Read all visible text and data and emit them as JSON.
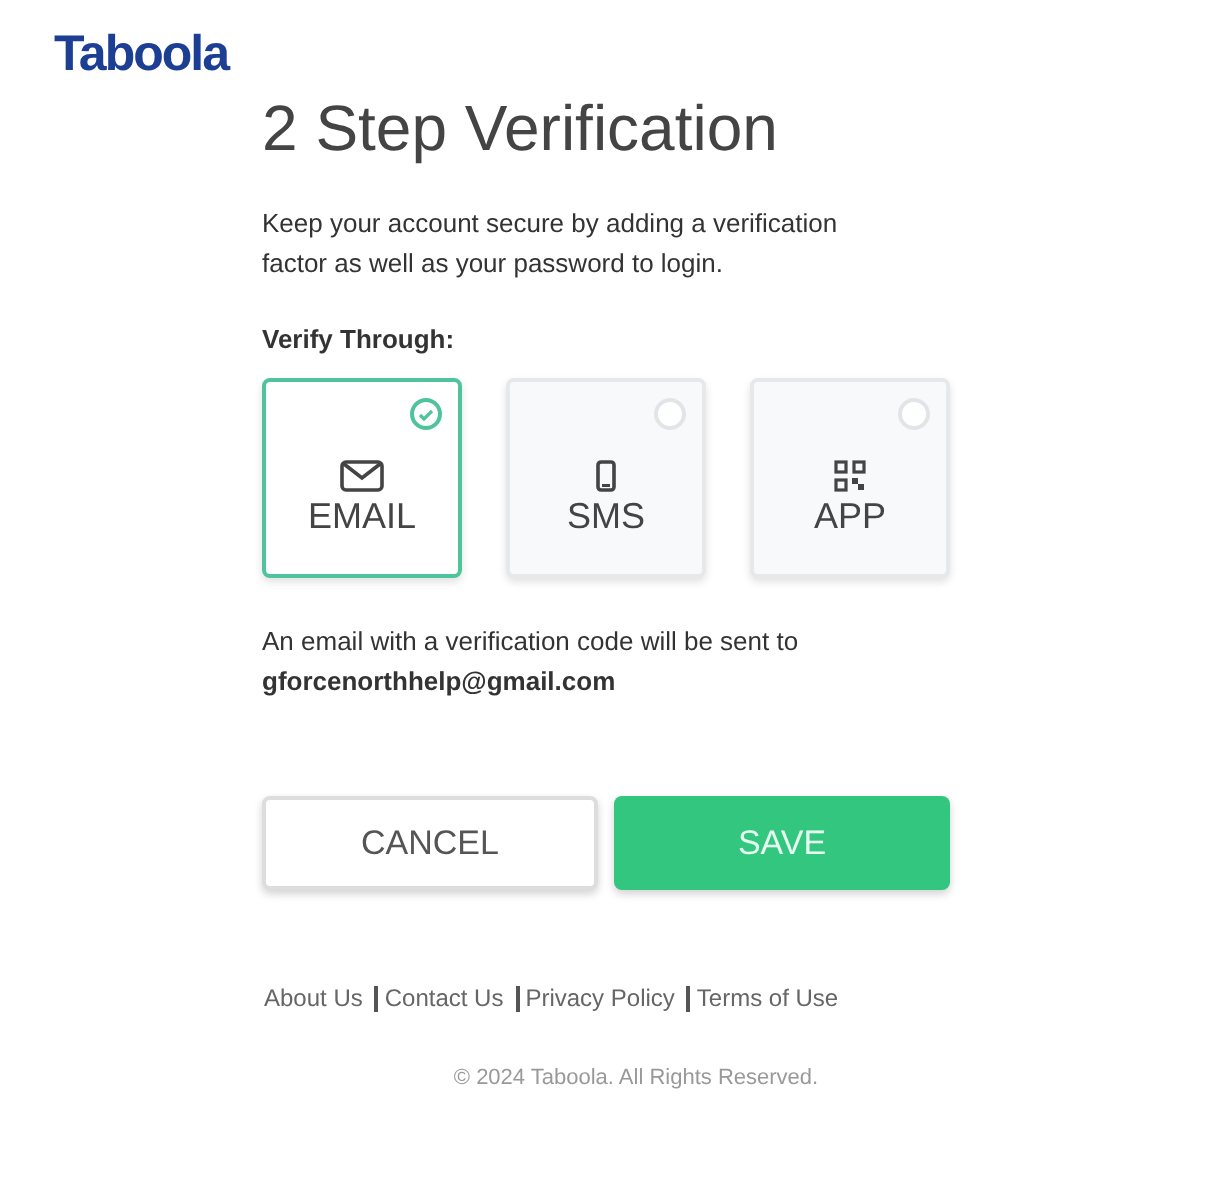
{
  "logo": "Taboola",
  "title": "2 Step Verification",
  "description": "Keep your account secure by adding a verification factor as well as your password to login.",
  "verify_label": "Verify Through:",
  "methods": [
    {
      "kind": "email",
      "label": "EMAIL",
      "selected": true
    },
    {
      "kind": "sms",
      "label": "SMS",
      "selected": false
    },
    {
      "kind": "app",
      "label": "APP",
      "selected": false
    }
  ],
  "notice": "An email with a verification code will be sent to",
  "email": "gforcenorthhelp@gmail.com",
  "buttons": [
    {
      "kind": "secondary",
      "label": "CANCEL"
    },
    {
      "kind": "primary",
      "label": "SAVE"
    }
  ],
  "footer_links": [
    "About Us",
    "Contact Us",
    "Privacy Policy",
    "Terms of Use"
  ],
  "copyright": "© 2024 Taboola. All Rights Reserved."
}
